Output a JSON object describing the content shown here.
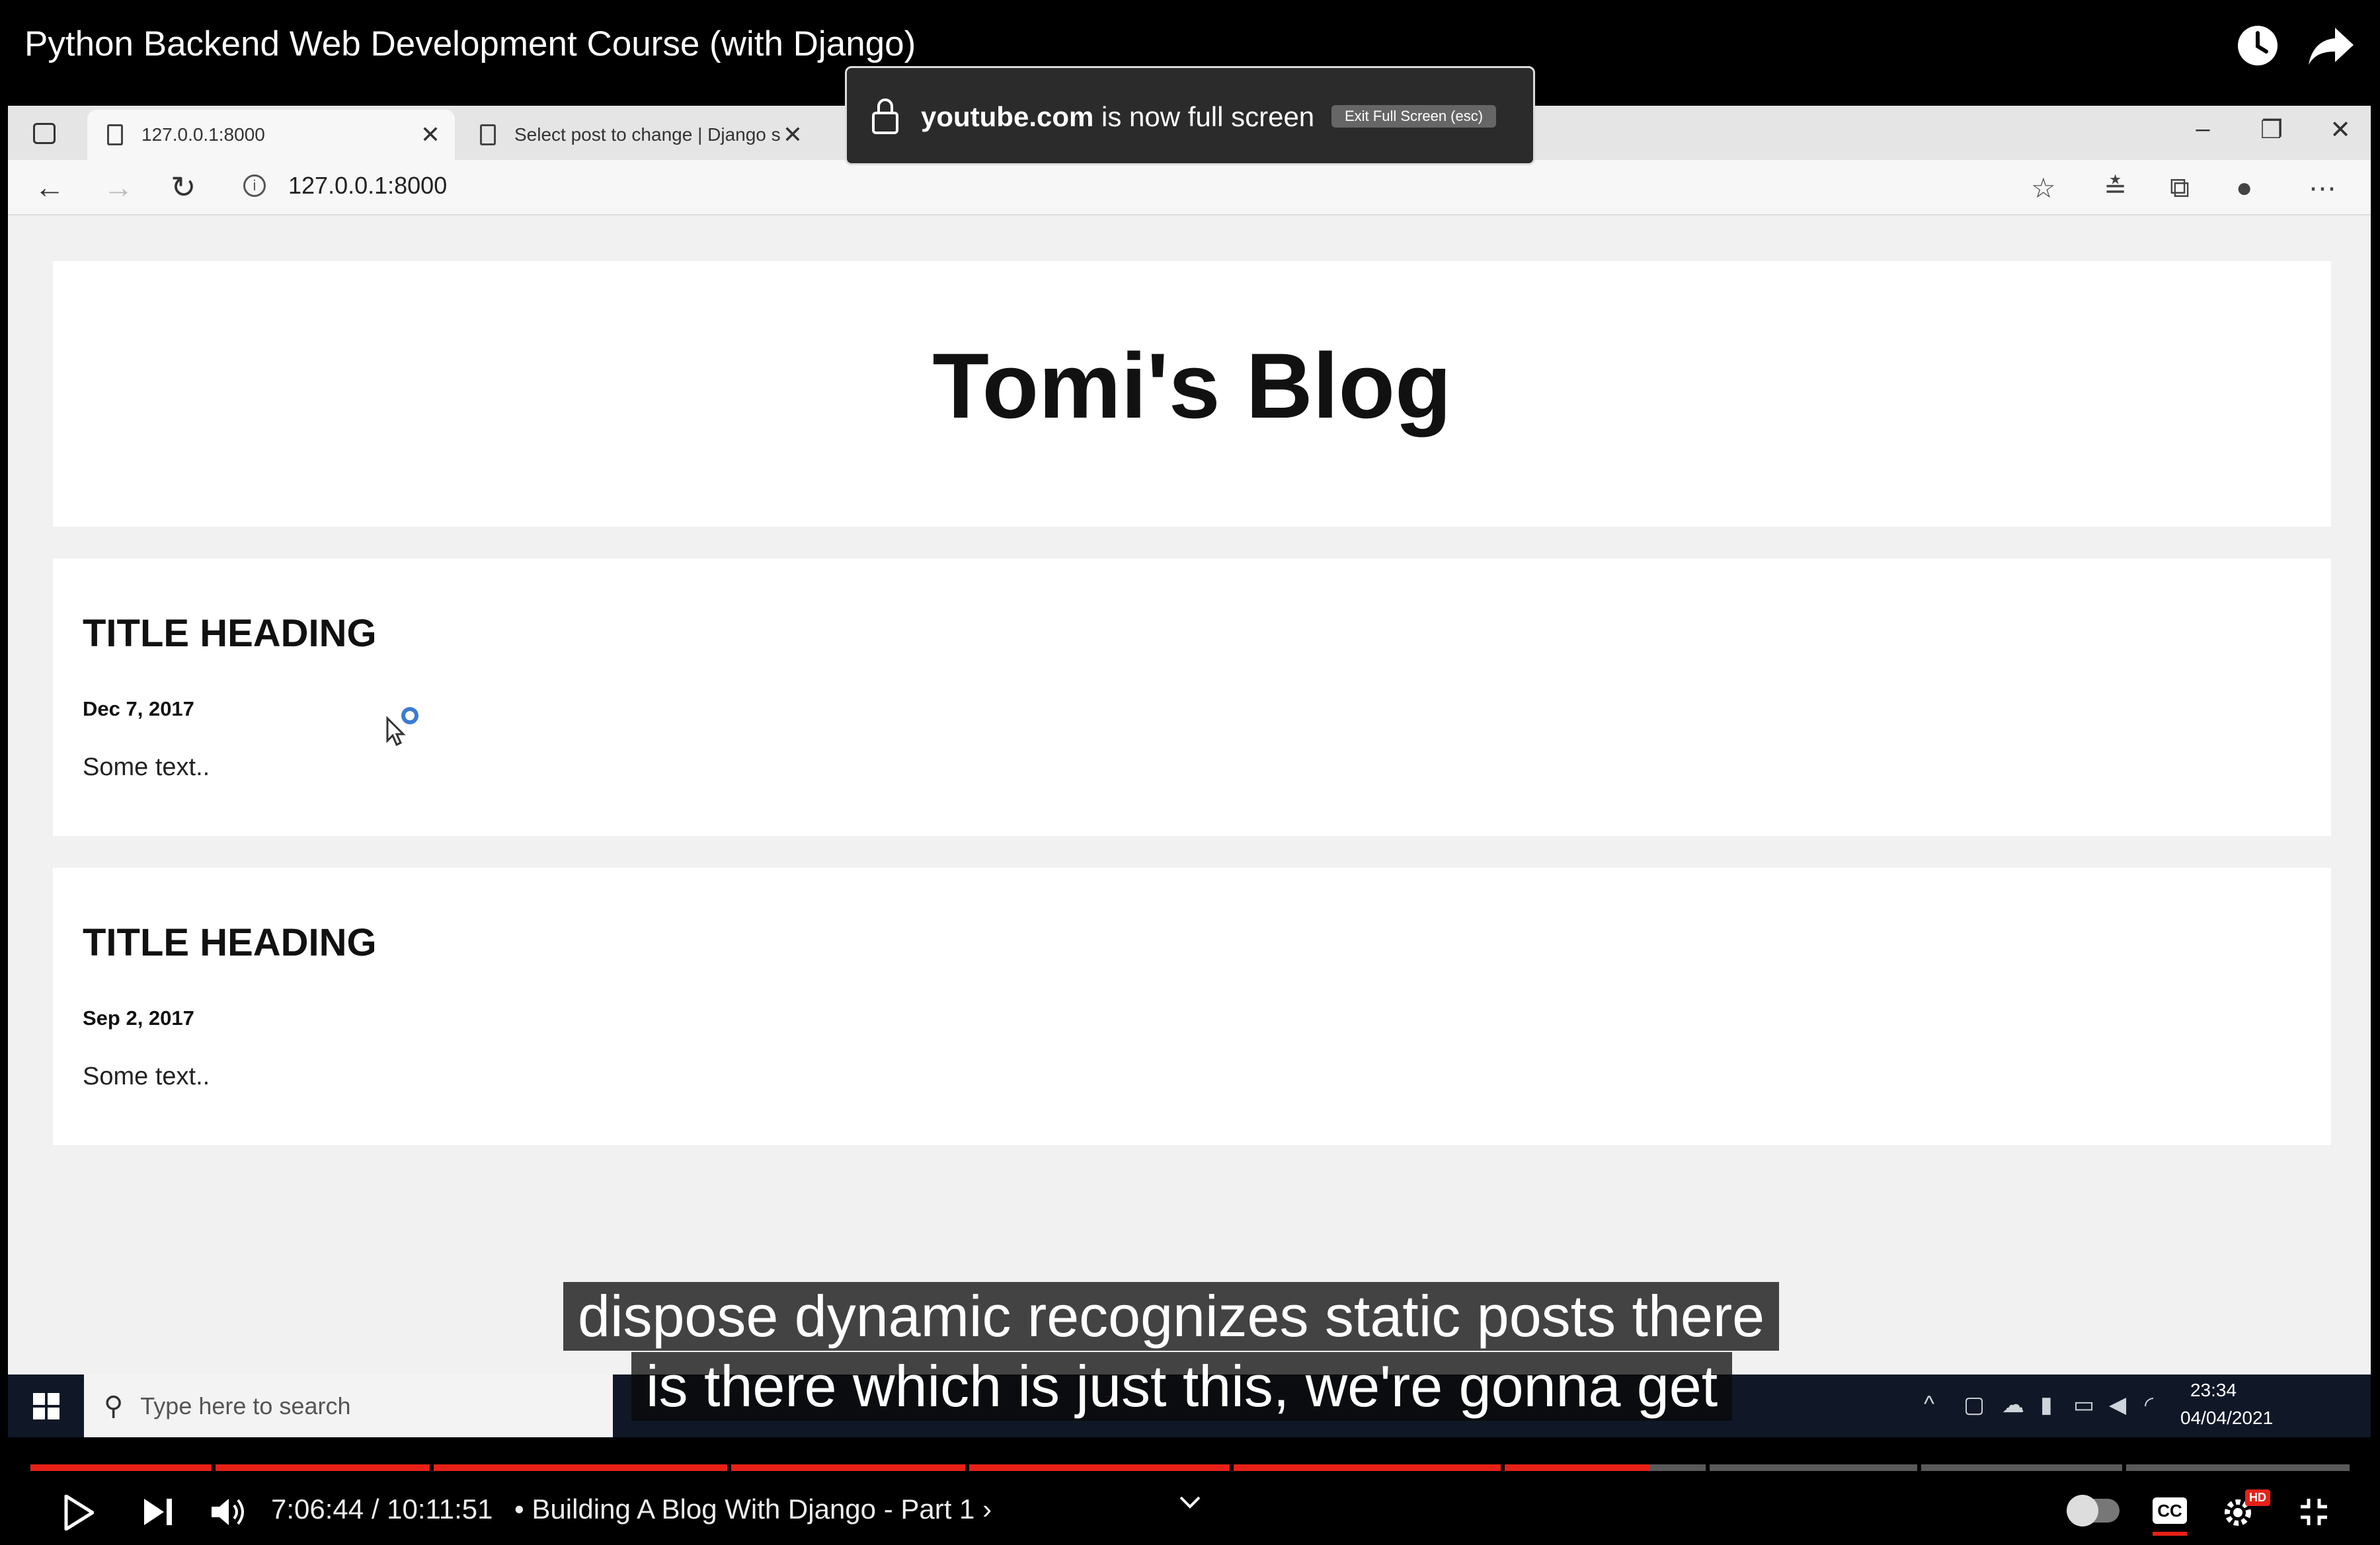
{
  "video": {
    "title": "Python Backend Web Development Course (with Django)",
    "time_current": "7:06:44",
    "time_separator": "/",
    "time_total": "10:11:51",
    "chapter": "• Building A Blog With Django - Part 1 ›",
    "progress": 0.698,
    "captions": [
      "dispose dynamic recognizes static posts there",
      "is there which is just this, we're gonna get"
    ]
  },
  "browser": {
    "tabs": [
      {
        "label": "127.0.0.1:8000",
        "active": true
      },
      {
        "label": "Select post to change | Django s",
        "active": false
      }
    ],
    "url": "127.0.0.1:8000",
    "fullscreen_notice": {
      "domain": "youtube.com",
      "message": "is now full screen",
      "exit_label": "Exit Full Screen (esc)"
    }
  },
  "page": {
    "blog_title": "Tomi's Blog",
    "posts": [
      {
        "title": "TITLE HEADING",
        "date": "Dec 7, 2017",
        "text": "Some text.."
      },
      {
        "title": "TITLE HEADING",
        "date": "Sep 2, 2017",
        "text": "Some text.."
      }
    ]
  },
  "taskbar": {
    "search_placeholder": "Type here to search",
    "time": "23:34",
    "date": "04/04/2021"
  },
  "colors": {
    "accent": "#e62117",
    "player_bg": "#000000",
    "page_bg": "#f1f1f1"
  }
}
